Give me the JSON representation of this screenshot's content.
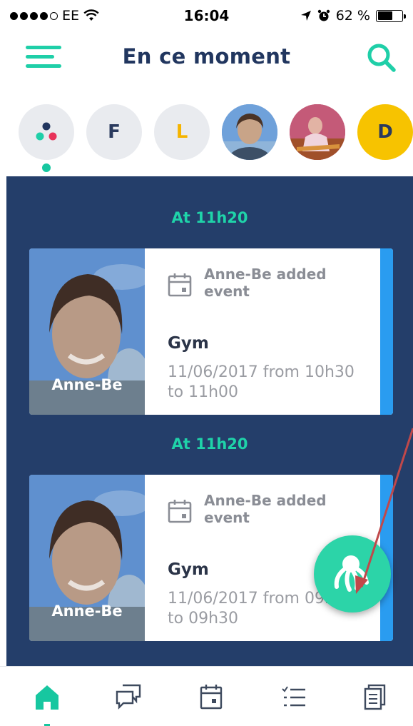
{
  "status_bar": {
    "carrier": "EE",
    "time": "16:04",
    "battery": "62 %",
    "battery_level": 0.62
  },
  "header": {
    "title": "En ce moment",
    "menu_icon": "hamburger-menu-icon",
    "search_icon": "search-icon"
  },
  "avatars": {
    "items": [
      {
        "label": "",
        "kind": "all-dots",
        "selected": true
      },
      {
        "label": "F",
        "kind": "initial",
        "color": "#2a3a5e"
      },
      {
        "label": "L",
        "kind": "initial",
        "color": "#f5b400"
      },
      {
        "label": "",
        "kind": "photo"
      },
      {
        "label": "",
        "kind": "photo"
      },
      {
        "label": "D",
        "kind": "initial",
        "color": "#2a3a5e",
        "bg": "#f7c300"
      }
    ]
  },
  "feed": {
    "entries": [
      {
        "time_label": "At 11h20",
        "person": "Anne-Be",
        "actor_text": "Anne-Be  added event",
        "event_title": "Gym",
        "event_date": "11/06/2017 from 10h30 to 11h00"
      },
      {
        "time_label": "At 11h20",
        "person": "Anne-Be",
        "actor_text": "Anne-Be  added event",
        "event_title": "Gym",
        "event_date": "11/06/2017 from 09h00 to 09h30"
      }
    ],
    "accent_color": "#1fd3a9",
    "background": "#243e6a"
  },
  "fab": {
    "icon": "octopus-icon"
  },
  "tabbar": {
    "items": [
      {
        "icon": "home-icon",
        "active": true
      },
      {
        "icon": "chat-icon",
        "active": false
      },
      {
        "icon": "calendar-icon",
        "active": false
      },
      {
        "icon": "checklist-icon",
        "active": false
      },
      {
        "icon": "documents-icon",
        "active": false
      }
    ]
  }
}
